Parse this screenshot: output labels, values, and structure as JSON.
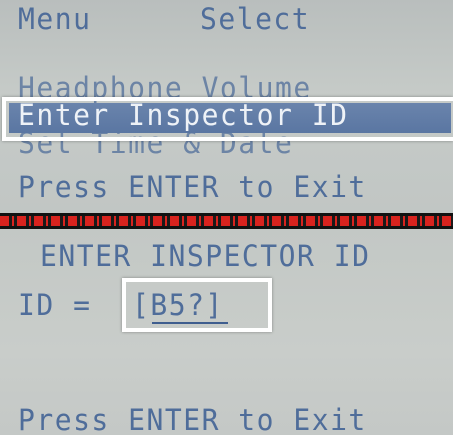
{
  "menu_screen": {
    "title_left": "Menu",
    "title_right": "Select",
    "items": [
      {
        "label": "Headphone Volume"
      },
      {
        "label": "Enter Inspector ID",
        "selected": true
      },
      {
        "label": "Set Time & Date"
      }
    ],
    "exit_hint": "Press ENTER to Exit"
  },
  "inspector_screen": {
    "heading": "ENTER INSPECTOR ID",
    "id_label": "ID =",
    "id_value": "[B5?]",
    "exit_hint": "Press ENTER to Exit"
  },
  "colors": {
    "lcd_background": "#c4c9c6",
    "lcd_text": "#4f6d9a",
    "highlight_bar": "#5a76a2",
    "highlight_text": "#eef2f7",
    "divider": "#d8231e",
    "callout_frame": "#ffffff"
  }
}
